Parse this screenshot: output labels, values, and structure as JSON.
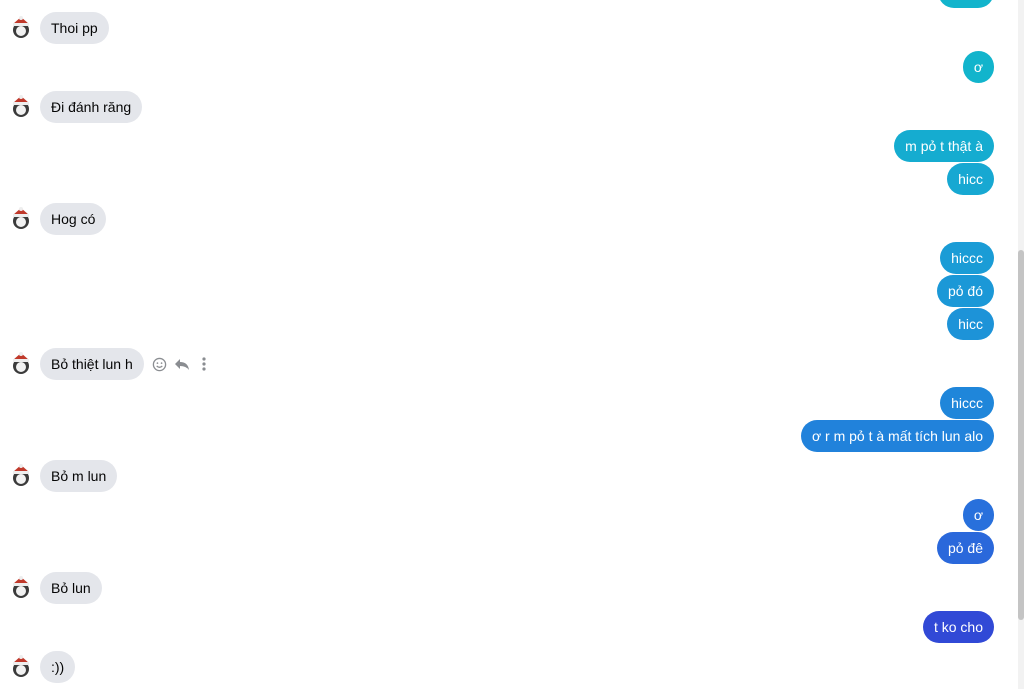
{
  "colors": {
    "incoming_bubble": "#e4e6eb",
    "outgoing_gradient": [
      "#0fb0c8",
      "#1a96d6",
      "#2080dc",
      "#2b5fd8",
      "#3145d6"
    ]
  },
  "incoming": [
    {
      "text": "Thoi pp"
    },
    {
      "text": "Đi đánh răng"
    },
    {
      "text": "Hog có"
    },
    {
      "text": "Bỏ thiệt lun h"
    },
    {
      "text": "Bỏ m lun"
    },
    {
      "text": "Bỏ lun"
    },
    {
      "text": ":))"
    }
  ],
  "outgoing": [
    {
      "text": "ơ"
    },
    {
      "text": "m pỏ t thật à"
    },
    {
      "text": "hicc"
    },
    {
      "text": "hiccc"
    },
    {
      "text": "pỏ đó"
    },
    {
      "text": "hicc"
    },
    {
      "text": "hiccc"
    },
    {
      "text": "ơ r m pỏ t à mất tích lun alo"
    },
    {
      "text": "ơ"
    },
    {
      "text": "pỏ đê"
    },
    {
      "text": "t ko cho"
    }
  ],
  "message_actions": [
    "react-icon",
    "reply-icon",
    "more-icon"
  ]
}
